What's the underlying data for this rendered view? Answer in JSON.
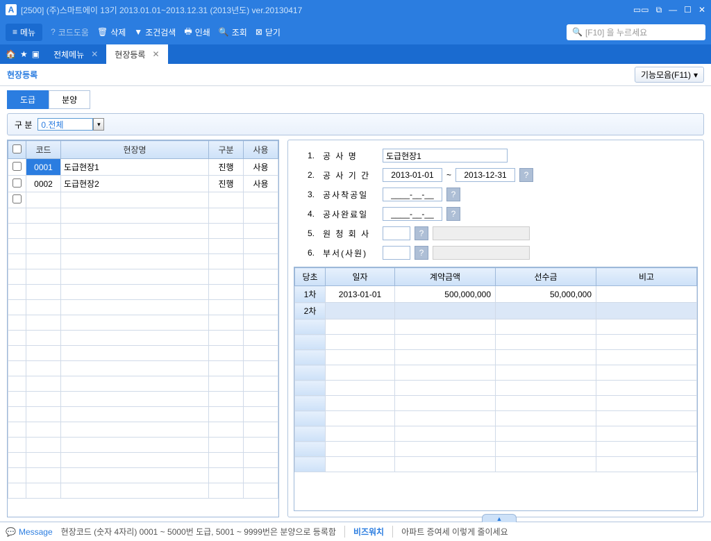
{
  "titlebar": {
    "text": "[2500]  (주)스마트에이   13기  2013.01.01~2013.12.31  (2013년도)   ver.20130417"
  },
  "toolbar": {
    "menu": "메뉴",
    "codeHelp": "코드도움",
    "delete": "삭제",
    "condSearch": "조건검색",
    "print": "인쇄",
    "query": "조회",
    "close": "닫기",
    "searchPlaceholder": "[F10] 을 누르세요"
  },
  "tabs": {
    "all": "전체메뉴",
    "site": "현장등록"
  },
  "subheader": {
    "title": "현장등록",
    "funcBtn": "기능모음(F11)"
  },
  "subtabs": {
    "t1": "도급",
    "t2": "분양"
  },
  "filter": {
    "label": "구     분",
    "value": "0.전체"
  },
  "leftGrid": {
    "headers": {
      "code": "코드",
      "name": "현장명",
      "kind": "구분",
      "use": "사용"
    },
    "rows": [
      {
        "code": "0001",
        "name": "도급현장1",
        "kind": "진행",
        "use": "사용",
        "selected": true
      },
      {
        "code": "0002",
        "name": "도급현장2",
        "kind": "진행",
        "use": "사용",
        "selected": false
      }
    ]
  },
  "form": {
    "l1": "공  사  명",
    "v1": "도급현장1",
    "l2": "공 사 기 간",
    "v2a": "2013-01-01",
    "tilde": "~",
    "v2b": "2013-12-31",
    "l3": "공사착공일",
    "v3": "____-__-__",
    "l4": "공사완료일",
    "v4": "____-__-__",
    "l5": "원 청 회 사",
    "l6": "부서(사원)"
  },
  "rgrid": {
    "headers": {
      "c0": "당초",
      "c1": "일자",
      "c2": "계약금액",
      "c3": "선수금",
      "c4": "비고"
    },
    "rows": [
      {
        "label": "1차",
        "date": "2013-01-01",
        "amt": "500,000,000",
        "adv": "50,000,000",
        "note": ""
      },
      {
        "label": "2차",
        "date": "",
        "amt": "",
        "adv": "",
        "note": "",
        "selrow": true
      }
    ]
  },
  "status": {
    "msgLabel": "Message",
    "msg": "현장코드 (숫자 4자리) 0001 ~ 5000번 도급, 5001 ~ 9999번은 분양으로 등록함",
    "biz": "비즈워치",
    "tip": "아파트 증여세 이렇게 줄이세요"
  }
}
